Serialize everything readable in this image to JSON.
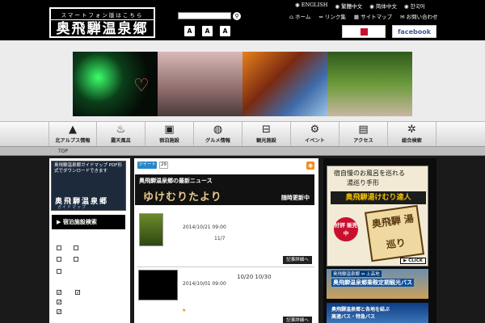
{
  "logo": {
    "small": "スマートフォン版はこちら",
    "main": "奥飛騨温泉郷"
  },
  "languages": [
    "ENGLISH",
    "繁體中文",
    "简体中文",
    "한국어"
  ],
  "top_nav": [
    "ホーム",
    "リンク集",
    "サイトマップ",
    "お問い合わせ"
  ],
  "font_size_buttons": [
    "A",
    "A",
    "A"
  ],
  "social": {
    "facebook": "facebook"
  },
  "menu": [
    {
      "label": "北アルプス情報",
      "icon": "mountain-icon"
    },
    {
      "label": "露天風呂",
      "icon": "hot-spring-icon"
    },
    {
      "label": "宿泊施設",
      "icon": "luggage-icon"
    },
    {
      "label": "グルメ情報",
      "icon": "dining-icon"
    },
    {
      "label": "観光施設",
      "icon": "ropeway-icon"
    },
    {
      "label": "イベント",
      "icon": "event-icon"
    },
    {
      "label": "アクセス",
      "icon": "train-icon"
    },
    {
      "label": "総合検索",
      "icon": "search-grid-icon"
    }
  ],
  "breadcrumb": "TOP",
  "left": {
    "map_banner_text": "奥飛騨温泉郷ガイドマップ PDF形式でダウンロードできます",
    "map_banner_title": "奥飛騨温泉郷",
    "map_banner_sub": "ガイドマップ",
    "search_heading": "宿泊施設検索"
  },
  "main": {
    "tweet": "ツイート",
    "tweet_count": "29",
    "news_heading": "奥飛騨温泉郷の最新ニュース",
    "news_title": "ゆけむりたより",
    "news_tag": "随時更新中",
    "items": [
      {
        "date": "2014/10/21 09:00",
        "text": "11/7",
        "more": "記事詳細へ"
      },
      {
        "date": "2014/10/01 09:00",
        "text": "10/20  10/30",
        "more": "記事詳細へ"
      }
    ]
  },
  "right": {
    "banner1": {
      "line1": "宿自慢のお風呂を巡れる",
      "line2": "湯巡り手形",
      "title": "奥飛騨湯けむり達人",
      "badge": "好評 販売中",
      "stamp": "奥飛騨 湯巡り",
      "click": "CLICK"
    },
    "banner2": {
      "line1": "奥飛騨温泉郷 ⇔ 上高地",
      "title": "奥飛騨温泉郷乗鞍定期観光バス"
    },
    "banner3": {
      "line1": "奥飛騨温泉郷と各地を結ぶ",
      "line2": "高速バス・特急バス"
    }
  }
}
